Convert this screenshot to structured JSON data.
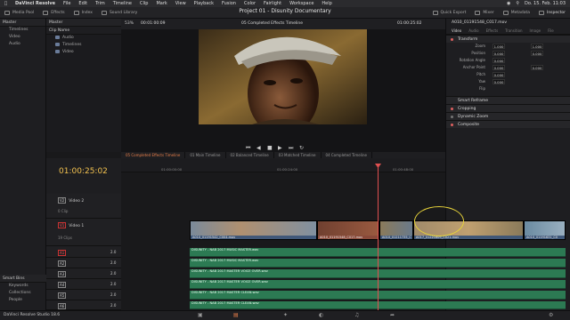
{
  "menubar": {
    "app": "DaVinci Resolve",
    "items": [
      "File",
      "Edit",
      "Trim",
      "Timeline",
      "Clip",
      "Mark",
      "View",
      "Playback",
      "Fusion",
      "Color",
      "Fairlight",
      "Workspace",
      "Help"
    ],
    "clock": "Do. 15. Feb. 11:03"
  },
  "toolbar": {
    "media_pool": "Media Pool",
    "effects": "Effects",
    "index": "Index",
    "sound_library": "Sound Library",
    "project_title": "Project 01 - Disunity Documentary",
    "quick_export": "Quick Export",
    "mixer": "Mixer",
    "metadata": "Metadata",
    "inspector": "Inspector"
  },
  "media_pool": {
    "master": "Master",
    "bins": [
      "Timelines",
      "Video",
      "Audio"
    ],
    "column": "Clip Name",
    "folders": [
      "Audio",
      "Timelines",
      "Video"
    ],
    "smart_bins": "Smart Bins",
    "smart_items": [
      "Keywords",
      "Collections",
      "People"
    ]
  },
  "viewer": {
    "zoom": "53%",
    "timecode_left": "00:01:00:09",
    "timeline_name": "05 Completed Effects Timeline",
    "timecode_right": "01:00:25:02"
  },
  "inspector": {
    "file": "A010_01191548_C017.mov",
    "tabs": [
      "Video",
      "Audio",
      "Effects",
      "Transition",
      "Image",
      "File"
    ],
    "transform": "Transform",
    "params": [
      {
        "label": "Zoom",
        "x": "1.000",
        "y": "1.000"
      },
      {
        "label": "Position",
        "x": "0.000",
        "y": "0.000"
      },
      {
        "label": "Rotation Angle",
        "x": "0.000",
        "y": ""
      },
      {
        "label": "Anchor Point",
        "x": "0.000",
        "y": "0.000"
      },
      {
        "label": "Pitch",
        "x": "0.000",
        "y": ""
      },
      {
        "label": "Yaw",
        "x": "0.000",
        "y": ""
      },
      {
        "label": "Flip",
        "x": "",
        "y": ""
      }
    ],
    "smart_reframe": "Smart Reframe",
    "sections": [
      "Cropping",
      "Dynamic Zoom",
      "Composite"
    ]
  },
  "timeline": {
    "tabs": [
      "05 Completed Effects Timeline",
      "01 Main Timeline",
      "02 Balanced Timeline",
      "03 Matched Timeline",
      "04 Completed Timeline"
    ],
    "timecode": "01:00:25:02",
    "ruler": [
      "01:00:00:00",
      "01:00:24:00",
      "01:00:48:00"
    ],
    "tracks": {
      "v2": {
        "id": "V2",
        "name": "Video 2",
        "count": "0 Clip"
      },
      "v1": {
        "id": "V1",
        "name": "Video 1",
        "count": "19 Clips"
      }
    },
    "video_clips": [
      "A010_01191542_C004.mov",
      "A010_01191548_C017.mov",
      "A010_01211735_C",
      "A017_01221609_C021.mov",
      "A010_01191631_C0"
    ],
    "audio": [
      {
        "id": "A1",
        "vol": "2.0",
        "clip": "DISUNITY - NAB 2017 MUSIC MASTER.wav"
      },
      {
        "id": "A2",
        "vol": "2.0",
        "clip": "DISUNITY - NAB 2017 MUSIC MASTER.wav"
      },
      {
        "id": "A3",
        "vol": "2.0",
        "clip": "DISUNITY - NAB 2017 MASTER VOICE OVER.wav"
      },
      {
        "id": "A4",
        "vol": "2.0",
        "clip": "DISUNITY - NAB 2017 MASTER VOICE OVER.wav"
      },
      {
        "id": "A5",
        "vol": "2.0",
        "clip": "DISUNITY - NAB 2017 MASTER CLEAN.wav"
      },
      {
        "id": "A6",
        "vol": "2.0",
        "clip": "DISUNITY - NAB 2017 MASTER CLEAN.wav"
      }
    ]
  },
  "footer": {
    "version": "DaVinci Resolve Studio 18.6"
  },
  "colors": {
    "accent": "#e87f4a",
    "timecode": "#f2c14f",
    "audio": "#2c7a53",
    "highlight": "#e6d23a"
  }
}
